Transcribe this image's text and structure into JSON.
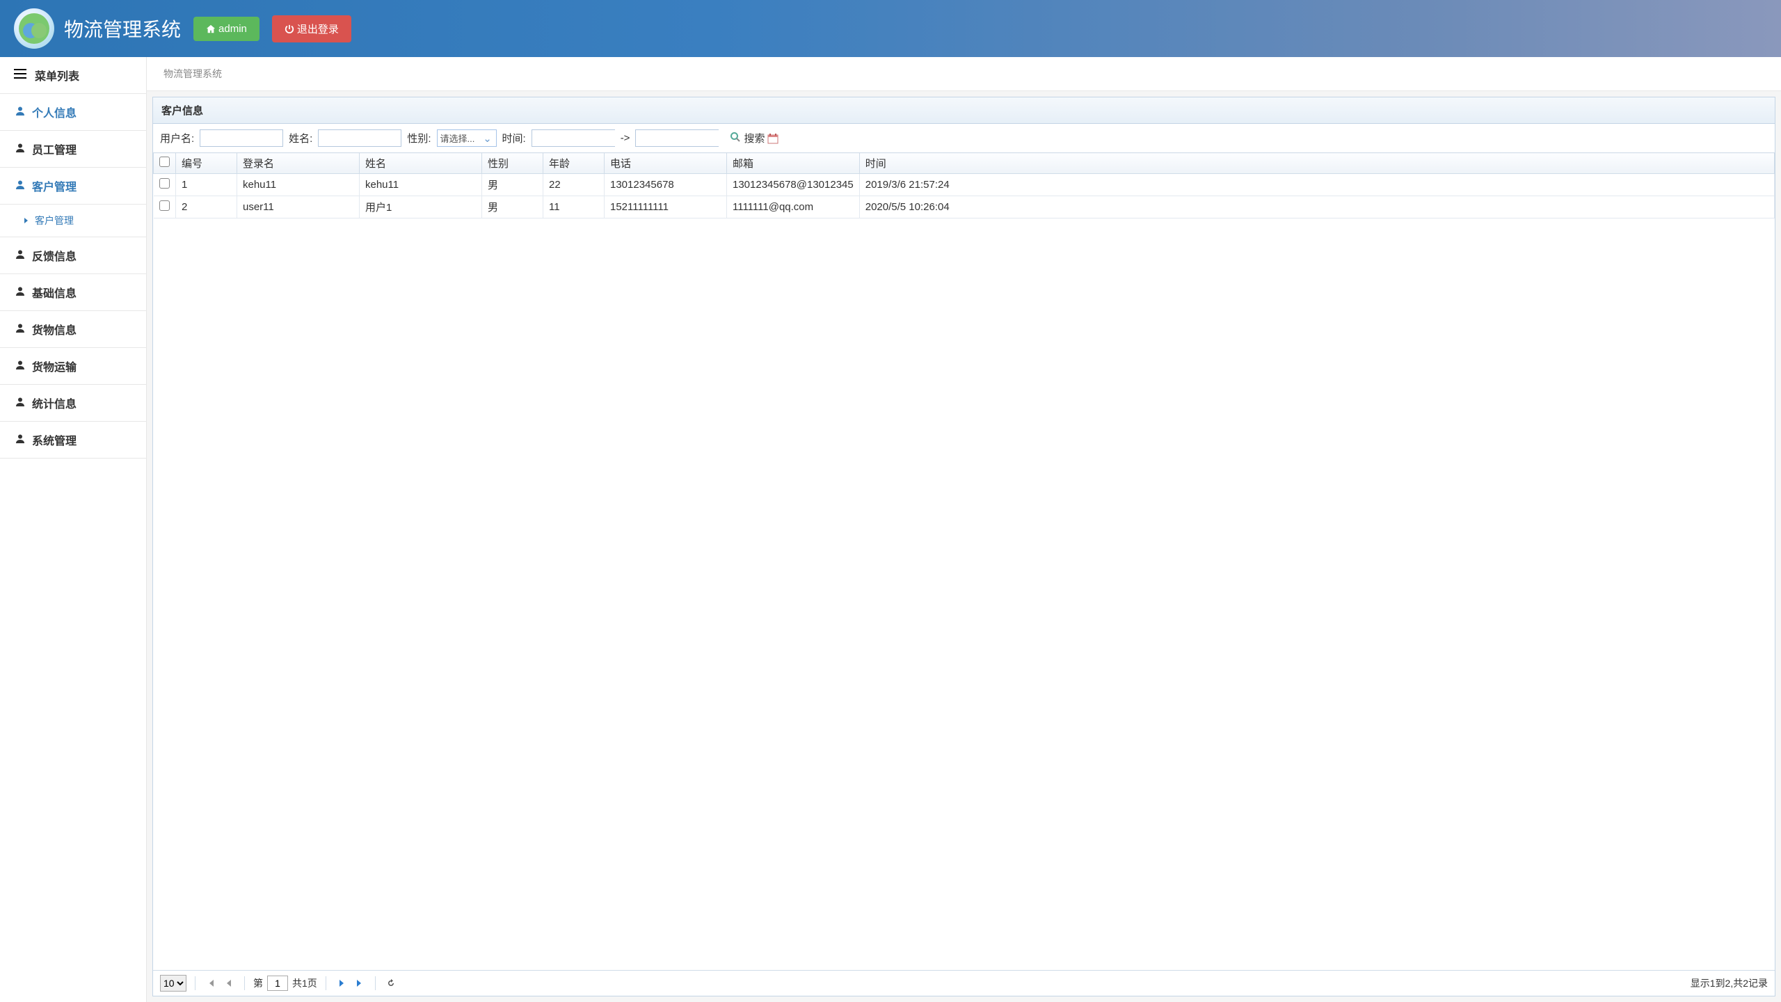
{
  "header": {
    "app_title": "物流管理系统",
    "admin_label": "admin",
    "logout_label": "退出登录"
  },
  "sidebar": {
    "title": "菜单列表",
    "items": [
      {
        "label": "个人信息",
        "active": true
      },
      {
        "label": "员工管理"
      },
      {
        "label": "客户管理",
        "active": true,
        "sub": [
          {
            "label": "客户管理"
          }
        ]
      },
      {
        "label": "反馈信息"
      },
      {
        "label": "基础信息"
      },
      {
        "label": "货物信息"
      },
      {
        "label": "货物运输"
      },
      {
        "label": "统计信息"
      },
      {
        "label": "系统管理"
      }
    ]
  },
  "breadcrumb": "物流管理系统",
  "panel": {
    "title": "客户信息",
    "filters": {
      "username_label": "用户名:",
      "name_label": "姓名:",
      "gender_label": "性别:",
      "gender_placeholder": "请选择...",
      "time_label": "时间:",
      "range_sep": "->",
      "search_label": "搜索"
    },
    "columns": [
      "编号",
      "登录名",
      "姓名",
      "性别",
      "年龄",
      "电话",
      "邮箱",
      "时间"
    ],
    "rows": [
      {
        "id": "1",
        "login": "kehu11",
        "name": "kehu11",
        "gender": "男",
        "age": "22",
        "phone": "13012345678",
        "email": "13012345678@13012345",
        "time": "2019/3/6 21:57:24"
      },
      {
        "id": "2",
        "login": "user11",
        "name": "用户1",
        "gender": "男",
        "age": "11",
        "phone": "15211111111",
        "email": "1111111@qq.com",
        "time": "2020/5/5 10:26:04"
      }
    ]
  },
  "pager": {
    "page_size": "10",
    "page_label_prefix": "第",
    "current_page": "1",
    "total_pages_label": "共1页",
    "summary": "显示1到2,共2记录"
  }
}
